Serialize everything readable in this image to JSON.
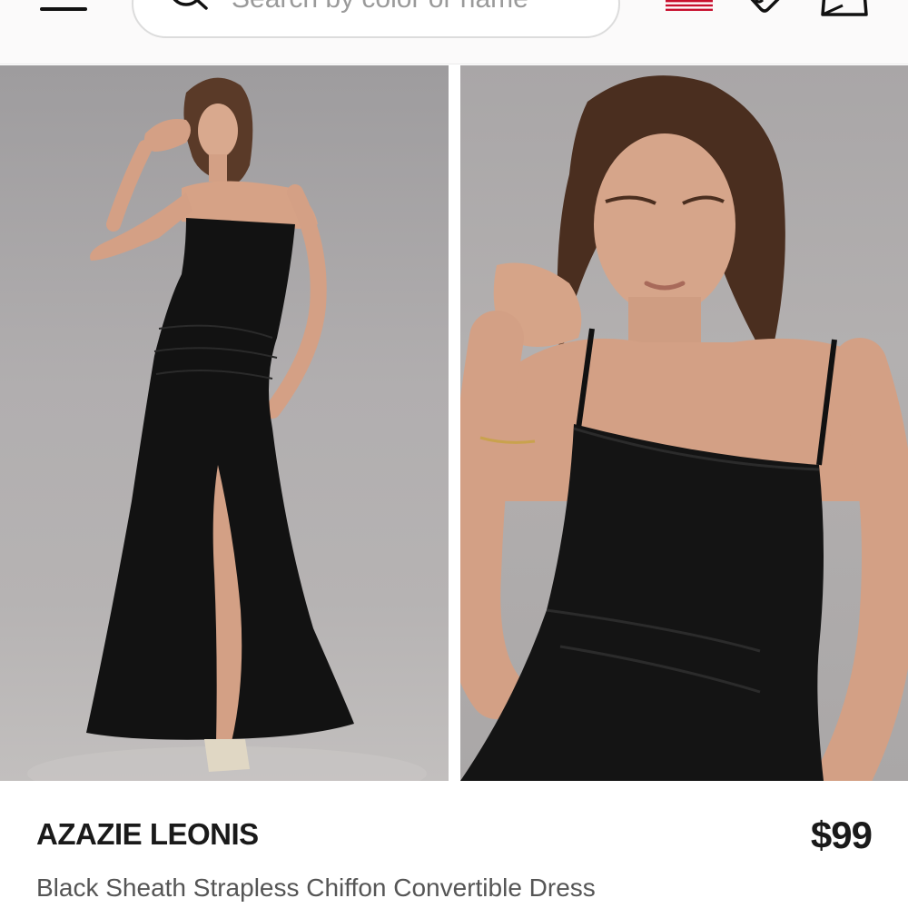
{
  "header": {
    "menu_icon": "hamburger-menu-icon",
    "search": {
      "placeholder": "Search by color or name",
      "icon": "search-icon"
    },
    "flag_icon": "us-flag-icon",
    "wishlist_icon": "heart-tag-icon",
    "bag_icon": "shopping-bag-icon"
  },
  "product": {
    "name": "AZAZIE LEONIS",
    "price": "$99",
    "description": "Black Sheath Strapless Chiffon Convertible Dress"
  },
  "images": [
    {
      "name": "full-length-dress-photo"
    },
    {
      "name": "bodice-closeup-photo"
    }
  ],
  "colors": {
    "text_primary": "#1a1a1a",
    "text_secondary": "#555555",
    "header_bg": "#fbfafa",
    "flag_red": "#c8102e"
  }
}
